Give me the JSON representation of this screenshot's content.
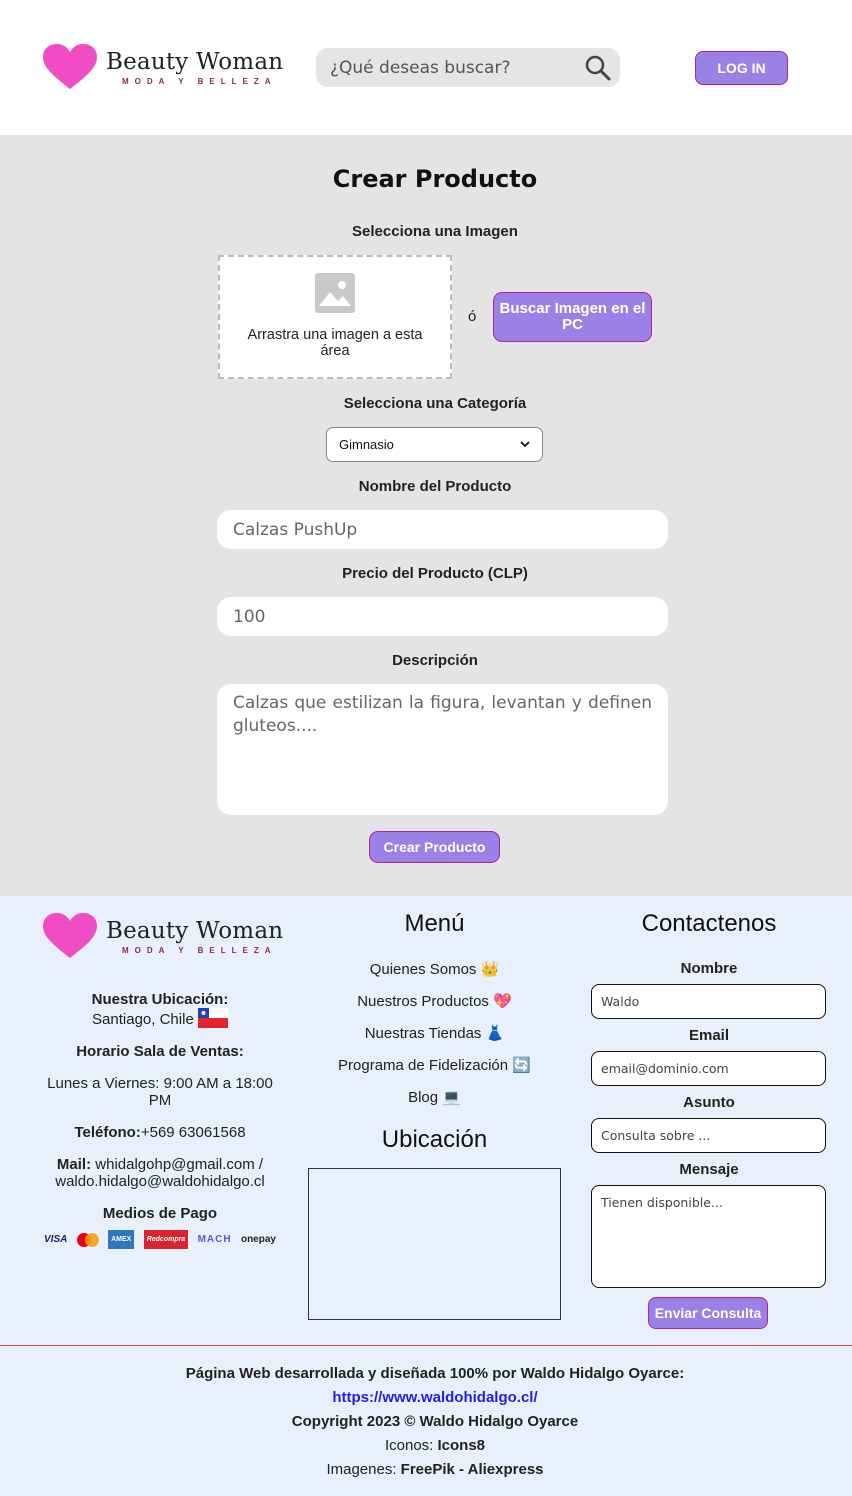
{
  "header": {
    "brand_name": "Beauty Woman",
    "brand_tagline": "MODA Y BELLEZA",
    "search_placeholder": "¿Qué deseas buscar?",
    "login_label": "LOG IN"
  },
  "form": {
    "title": "Crear Producto",
    "image_label": "Selecciona una Imagen",
    "drop_text": "Arrastra una imagen a esta área",
    "or_text": "ó",
    "browse_label": "Buscar Imagen en el PC",
    "category_label": "Selecciona una Categoría",
    "category_value": "Gimnasio",
    "name_label": "Nombre del Producto",
    "name_value": "Calzas PushUp",
    "price_label": "Precio del Producto (CLP)",
    "price_value": "100",
    "description_label": "Descripción",
    "description_value": "Calzas que estilizan la figura, levantan y definen gluteos....",
    "submit_label": "Crear Producto"
  },
  "footer": {
    "location_title": "Nuestra Ubicación:",
    "location_value": "Santiago, Chile",
    "hours_title": "Horario Sala de Ventas:",
    "hours_value": "Lunes a Viernes: 9:00 AM a 18:00 PM",
    "phone_label": "Teléfono:",
    "phone_value": "+569 63061568",
    "mail_label": "Mail:",
    "mail_value": "whidalgohp@gmail.com / waldo.hidalgo@waldohidalgo.cl",
    "payment_title": "Medios de Pago",
    "payment_methods": [
      "VISA",
      "Mastercard",
      "AMEX",
      "Redcompra",
      "MACH",
      "onepay"
    ],
    "menu_title": "Menú",
    "menu_items": [
      "Quienes Somos 👑",
      "Nuestros Productos 💖",
      "Nuestras Tiendas 👗",
      "Programa de Fidelización 🔄",
      "Blog 💻"
    ],
    "map_title": "Ubicación",
    "contact_title": "Contactenos",
    "contact_name_label": "Nombre",
    "contact_name_value": "Waldo",
    "contact_email_label": "Email",
    "contact_email_placeholder": "email@dominio.com",
    "contact_subject_label": "Asunto",
    "contact_subject_placeholder": "Consulta sobre ...",
    "contact_message_label": "Mensaje",
    "contact_message_placeholder": "Tienen disponible...",
    "send_label": "Enviar Consulta",
    "credit_line": "Página Web desarrollada y diseñada 100% por Waldo Hidalgo Oyarce:",
    "credit_url": "https://www.waldohidalgo.cl/",
    "copyright": "Copyright 2023 © Waldo Hidalgo Oyarce",
    "icons_label": "Iconos: ",
    "icons_value": "Icons8",
    "images_label": "Imagenes: ",
    "images_value": "FreePik - Aliexpress"
  },
  "colors": {
    "accent": "#9a81e6",
    "accent_border": "#b3229a",
    "heart": "#f04dc4",
    "main_bg": "#e4e4e4",
    "footer_bg": "#e8f0fb"
  }
}
